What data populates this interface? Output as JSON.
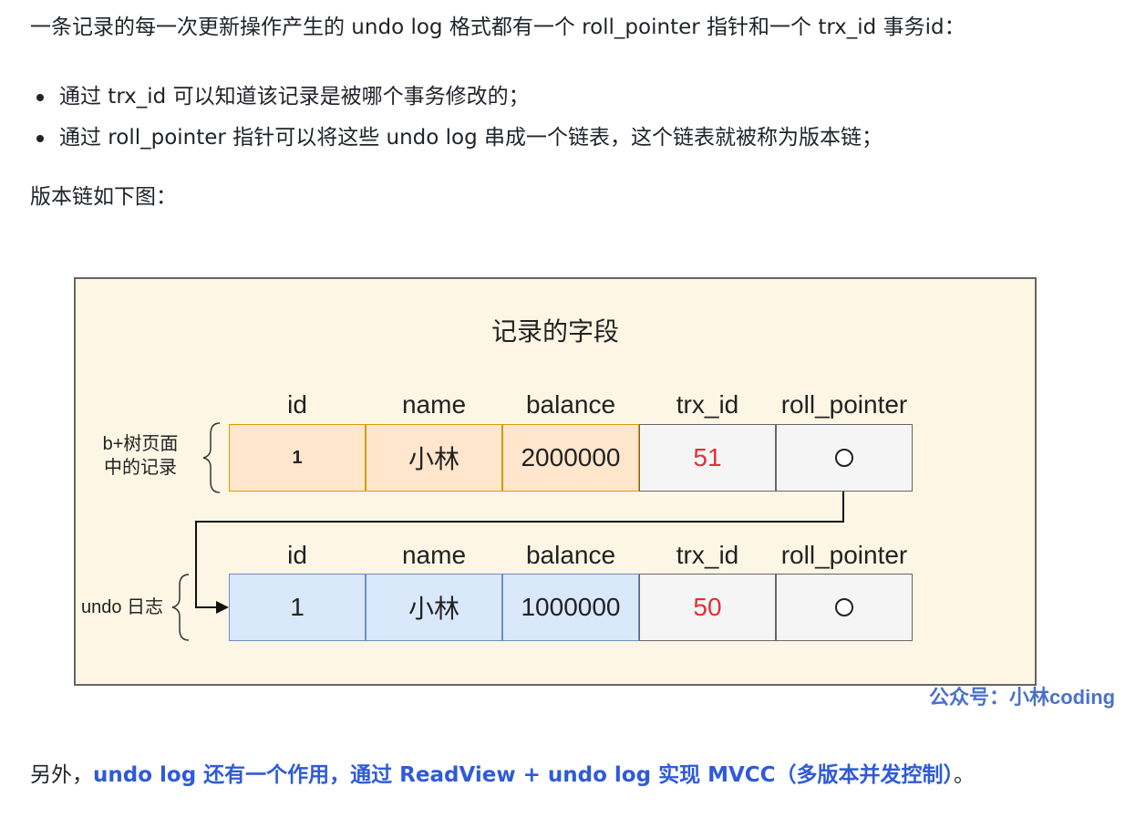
{
  "intro": "一条记录的每一次更新操作产生的 undo log 格式都有一个 roll_pointer 指针和一个 trx_id 事务id：",
  "bullets": [
    "通过 trx_id 可以知道该记录是被哪个事务修改的；",
    "通过 roll_pointer 指针可以将这些 undo log 串成一个链表，这个链表就被称为版本链；"
  ],
  "caption": "版本链如下图：",
  "diagram": {
    "title": "记录的字段",
    "headers": [
      "id",
      "name",
      "balance",
      "trx_id",
      "roll_pointer"
    ],
    "record_label": "b+树页面\n中的记录",
    "record_row": {
      "id": "1",
      "name": "小林",
      "balance": "2000000",
      "trx_id": "51"
    },
    "undo_label": "undo 日志",
    "undo_row": {
      "id": "1",
      "name": "小林",
      "balance": "1000000",
      "trx_id": "50"
    }
  },
  "watermark": "公众号：小林coding",
  "footer": {
    "prefix": "另外，",
    "highlight": "undo log 还有一个作用，通过 ReadView + undo log 实现 MVCC（多版本并发控制）",
    "suffix": "。"
  },
  "colors": {
    "highlight": "#2f5bd8",
    "trx_id": "#e0303a",
    "record_fill": "#ffe6cc",
    "undo_fill": "#dae8fc"
  }
}
